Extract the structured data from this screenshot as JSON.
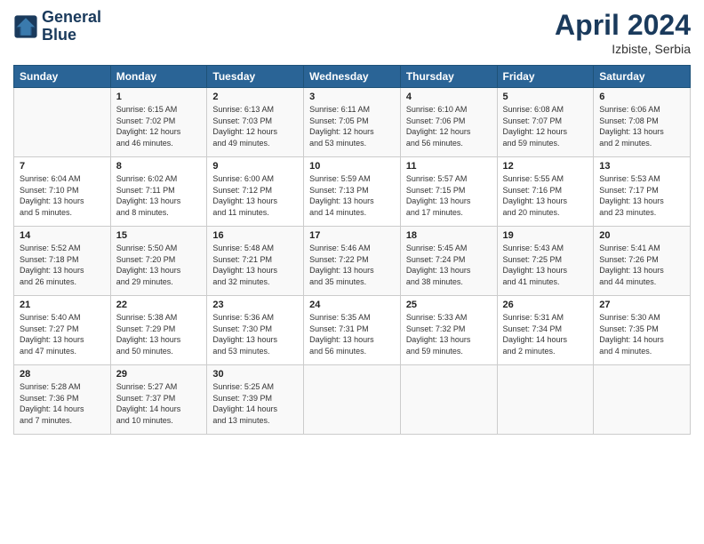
{
  "header": {
    "logo_line1": "General",
    "logo_line2": "Blue",
    "month": "April 2024",
    "location": "Izbiste, Serbia"
  },
  "columns": [
    "Sunday",
    "Monday",
    "Tuesday",
    "Wednesday",
    "Thursday",
    "Friday",
    "Saturday"
  ],
  "weeks": [
    [
      {
        "day": "",
        "text": ""
      },
      {
        "day": "1",
        "text": "Sunrise: 6:15 AM\nSunset: 7:02 PM\nDaylight: 12 hours\nand 46 minutes."
      },
      {
        "day": "2",
        "text": "Sunrise: 6:13 AM\nSunset: 7:03 PM\nDaylight: 12 hours\nand 49 minutes."
      },
      {
        "day": "3",
        "text": "Sunrise: 6:11 AM\nSunset: 7:05 PM\nDaylight: 12 hours\nand 53 minutes."
      },
      {
        "day": "4",
        "text": "Sunrise: 6:10 AM\nSunset: 7:06 PM\nDaylight: 12 hours\nand 56 minutes."
      },
      {
        "day": "5",
        "text": "Sunrise: 6:08 AM\nSunset: 7:07 PM\nDaylight: 12 hours\nand 59 minutes."
      },
      {
        "day": "6",
        "text": "Sunrise: 6:06 AM\nSunset: 7:08 PM\nDaylight: 13 hours\nand 2 minutes."
      }
    ],
    [
      {
        "day": "7",
        "text": "Sunrise: 6:04 AM\nSunset: 7:10 PM\nDaylight: 13 hours\nand 5 minutes."
      },
      {
        "day": "8",
        "text": "Sunrise: 6:02 AM\nSunset: 7:11 PM\nDaylight: 13 hours\nand 8 minutes."
      },
      {
        "day": "9",
        "text": "Sunrise: 6:00 AM\nSunset: 7:12 PM\nDaylight: 13 hours\nand 11 minutes."
      },
      {
        "day": "10",
        "text": "Sunrise: 5:59 AM\nSunset: 7:13 PM\nDaylight: 13 hours\nand 14 minutes."
      },
      {
        "day": "11",
        "text": "Sunrise: 5:57 AM\nSunset: 7:15 PM\nDaylight: 13 hours\nand 17 minutes."
      },
      {
        "day": "12",
        "text": "Sunrise: 5:55 AM\nSunset: 7:16 PM\nDaylight: 13 hours\nand 20 minutes."
      },
      {
        "day": "13",
        "text": "Sunrise: 5:53 AM\nSunset: 7:17 PM\nDaylight: 13 hours\nand 23 minutes."
      }
    ],
    [
      {
        "day": "14",
        "text": "Sunrise: 5:52 AM\nSunset: 7:18 PM\nDaylight: 13 hours\nand 26 minutes."
      },
      {
        "day": "15",
        "text": "Sunrise: 5:50 AM\nSunset: 7:20 PM\nDaylight: 13 hours\nand 29 minutes."
      },
      {
        "day": "16",
        "text": "Sunrise: 5:48 AM\nSunset: 7:21 PM\nDaylight: 13 hours\nand 32 minutes."
      },
      {
        "day": "17",
        "text": "Sunrise: 5:46 AM\nSunset: 7:22 PM\nDaylight: 13 hours\nand 35 minutes."
      },
      {
        "day": "18",
        "text": "Sunrise: 5:45 AM\nSunset: 7:24 PM\nDaylight: 13 hours\nand 38 minutes."
      },
      {
        "day": "19",
        "text": "Sunrise: 5:43 AM\nSunset: 7:25 PM\nDaylight: 13 hours\nand 41 minutes."
      },
      {
        "day": "20",
        "text": "Sunrise: 5:41 AM\nSunset: 7:26 PM\nDaylight: 13 hours\nand 44 minutes."
      }
    ],
    [
      {
        "day": "21",
        "text": "Sunrise: 5:40 AM\nSunset: 7:27 PM\nDaylight: 13 hours\nand 47 minutes."
      },
      {
        "day": "22",
        "text": "Sunrise: 5:38 AM\nSunset: 7:29 PM\nDaylight: 13 hours\nand 50 minutes."
      },
      {
        "day": "23",
        "text": "Sunrise: 5:36 AM\nSunset: 7:30 PM\nDaylight: 13 hours\nand 53 minutes."
      },
      {
        "day": "24",
        "text": "Sunrise: 5:35 AM\nSunset: 7:31 PM\nDaylight: 13 hours\nand 56 minutes."
      },
      {
        "day": "25",
        "text": "Sunrise: 5:33 AM\nSunset: 7:32 PM\nDaylight: 13 hours\nand 59 minutes."
      },
      {
        "day": "26",
        "text": "Sunrise: 5:31 AM\nSunset: 7:34 PM\nDaylight: 14 hours\nand 2 minutes."
      },
      {
        "day": "27",
        "text": "Sunrise: 5:30 AM\nSunset: 7:35 PM\nDaylight: 14 hours\nand 4 minutes."
      }
    ],
    [
      {
        "day": "28",
        "text": "Sunrise: 5:28 AM\nSunset: 7:36 PM\nDaylight: 14 hours\nand 7 minutes."
      },
      {
        "day": "29",
        "text": "Sunrise: 5:27 AM\nSunset: 7:37 PM\nDaylight: 14 hours\nand 10 minutes."
      },
      {
        "day": "30",
        "text": "Sunrise: 5:25 AM\nSunset: 7:39 PM\nDaylight: 14 hours\nand 13 minutes."
      },
      {
        "day": "",
        "text": ""
      },
      {
        "day": "",
        "text": ""
      },
      {
        "day": "",
        "text": ""
      },
      {
        "day": "",
        "text": ""
      }
    ]
  ]
}
